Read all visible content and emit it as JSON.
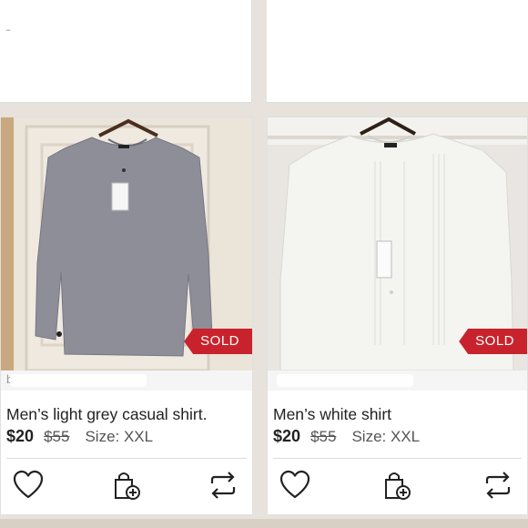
{
  "listings": [
    {
      "title": "Men’s light grey casual shirt.",
      "price": "$20",
      "original_price": "$55",
      "size": "Size: XXL",
      "badge": "SOLD",
      "seller_initial": "b",
      "shirt_color": "#8e8e98",
      "icons": [
        "heart-icon",
        "bundle-bag-icon",
        "share-icon"
      ]
    },
    {
      "title": "Men’s white shirt",
      "price": "$20",
      "original_price": "$55",
      "size": "Size: XXL",
      "badge": "SOLD",
      "shirt_color": "#f2f2f0",
      "icons": [
        "heart-icon",
        "bundle-bag-icon",
        "share-icon"
      ]
    }
  ],
  "colors": {
    "sold_badge": "#c8232c",
    "text": "#222222"
  }
}
